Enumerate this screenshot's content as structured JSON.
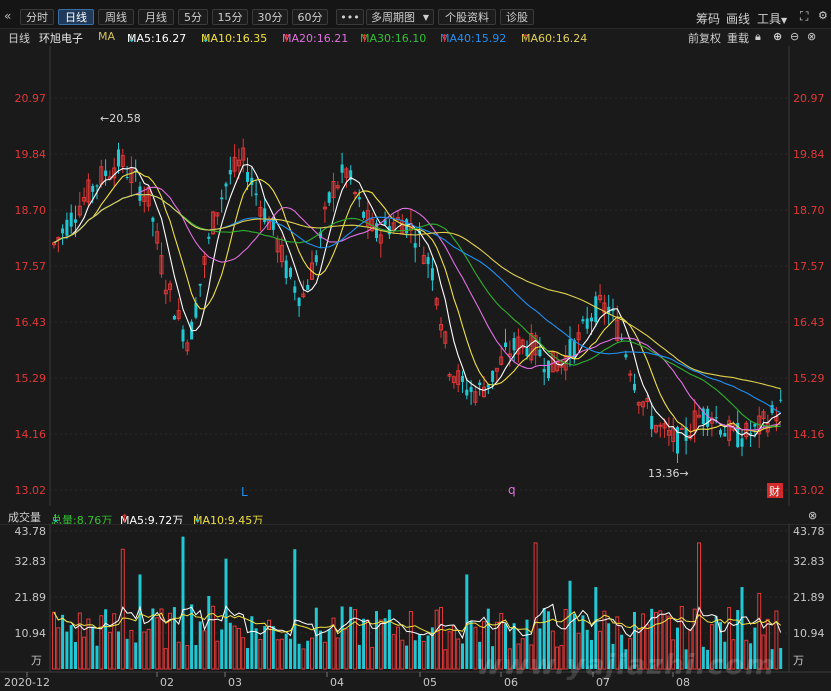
{
  "toolbar": {
    "back_icon": "«",
    "periods": [
      "分时",
      "日线",
      "周线",
      "月线",
      "5分",
      "15分",
      "30分",
      "60分"
    ],
    "active_period": "日线",
    "more_label": "•••",
    "multi_period": "多周期图",
    "stock_info": "个股资料",
    "diagnose": "诊股",
    "chips": "筹码",
    "draw_line": "画线",
    "tools": "工具"
  },
  "legend": {
    "period": "日线",
    "stock_name": "环旭电子",
    "ma_label": "MA",
    "ma5": "MA5:16.27",
    "ma10": "MA10:16.35",
    "ma20": "MA20:16.21",
    "ma30": "MA30:16.10",
    "ma40": "MA40:15.92",
    "ma60": "MA60:16.24",
    "up_arrow": "↑",
    "down_arrow": "↓",
    "fq": "前复权",
    "rebuild": "重载"
  },
  "colors": {
    "up": "#e03838",
    "down": "#22c7d4",
    "ma5": "#ffffff",
    "ma10": "#f0e040",
    "ma20": "#e070e0",
    "ma30": "#30b030",
    "ma40": "#2090f0",
    "ma60": "#e0d050"
  },
  "price_axis": [
    "20.97",
    "19.84",
    "18.70",
    "17.57",
    "16.43",
    "15.29",
    "14.16",
    "13.02"
  ],
  "annotations": {
    "high": "←20.58",
    "low": "13.36→",
    "marker_L": "L",
    "marker_q": "q",
    "cai": "财"
  },
  "volume": {
    "label": "成交量",
    "total": "总量:8.76万",
    "ma5": "MA5:9.72万",
    "ma10": "MA10:9.45万",
    "axis": [
      "43.78",
      "32.83",
      "21.89",
      "10.94"
    ],
    "unit": "万"
  },
  "date_axis": [
    "2020-12",
    "02",
    "03",
    "04",
    "05",
    "06",
    "07",
    "08"
  ],
  "watermark": "www.yajiazhi.com"
}
